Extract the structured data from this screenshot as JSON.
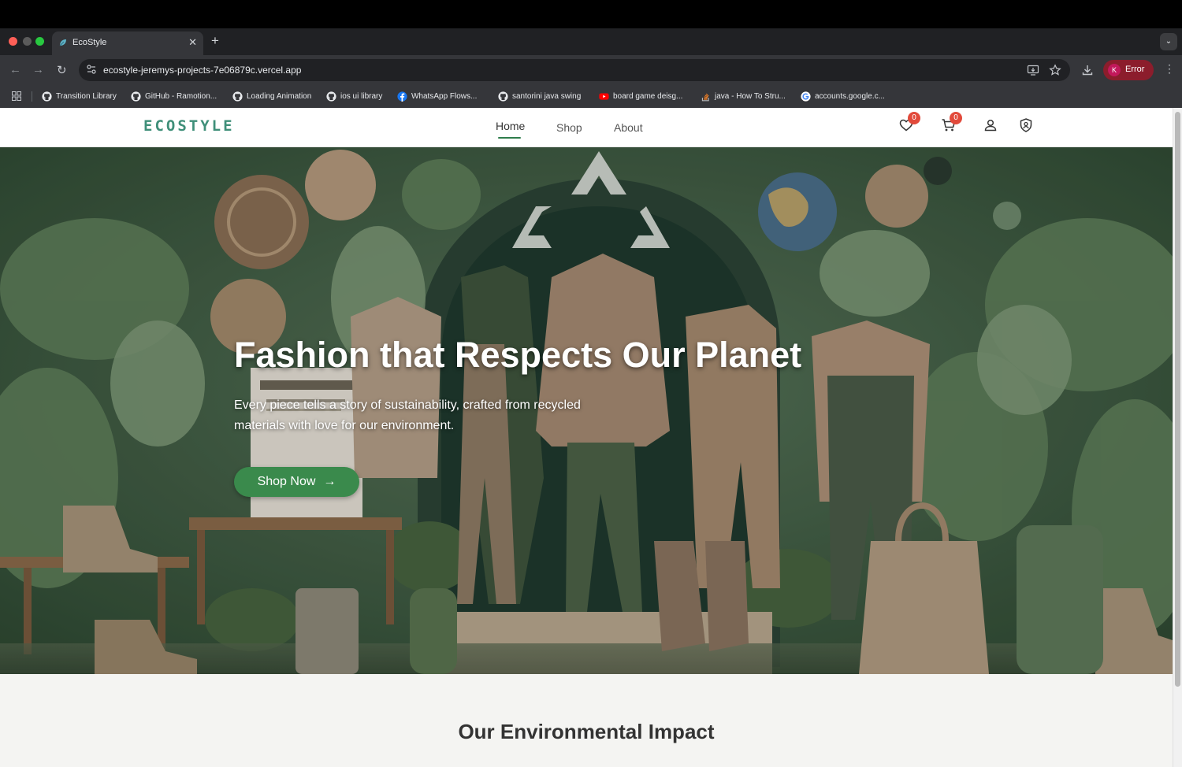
{
  "browser": {
    "tab": {
      "title": "EcoStyle",
      "close": "✕"
    },
    "new_tab": "+",
    "tab_search": "⌄",
    "nav": {
      "back": "←",
      "forward": "→",
      "reload": "↻"
    },
    "url": "ecostyle-jeremys-projects-7e06879c.vercel.app",
    "profile": {
      "initial": "K",
      "label": "Error"
    },
    "menu": "⋮",
    "bookmarks": [
      {
        "label": "Transition Library",
        "icon": "github-icon"
      },
      {
        "label": "GitHub - Ramotion...",
        "icon": "github-icon"
      },
      {
        "label": "Loading Animation",
        "icon": "github-icon"
      },
      {
        "label": "ios ui library",
        "icon": "github-icon"
      },
      {
        "label": "WhatsApp Flows...",
        "icon": "facebook-icon"
      },
      {
        "label": "santorini java swing",
        "icon": "github-icon"
      },
      {
        "label": "board game deisg...",
        "icon": "youtube-icon"
      },
      {
        "label": "java - How To Stru...",
        "icon": "stackoverflow-icon"
      },
      {
        "label": "accounts.google.c...",
        "icon": "google-icon"
      }
    ]
  },
  "site": {
    "logo": "ECOSTYLE",
    "nav": {
      "home": "Home",
      "shop": "Shop",
      "about": "About"
    },
    "wishlist_count": "0",
    "cart_count": "0",
    "hero": {
      "title": "Fashion that Respects Our Planet",
      "subtitle": "Every piece tells a story of sustainability, crafted from recycled materials with love for our environment.",
      "cta": "Shop Now",
      "cta_arrow": "→"
    },
    "impact_title": "Our Environmental Impact"
  },
  "colors": {
    "brand_green": "#3a8a4c",
    "logo_teal": "#3f8f79",
    "badge_red": "#e24a3b",
    "profile_red": "#8c1d2c"
  }
}
